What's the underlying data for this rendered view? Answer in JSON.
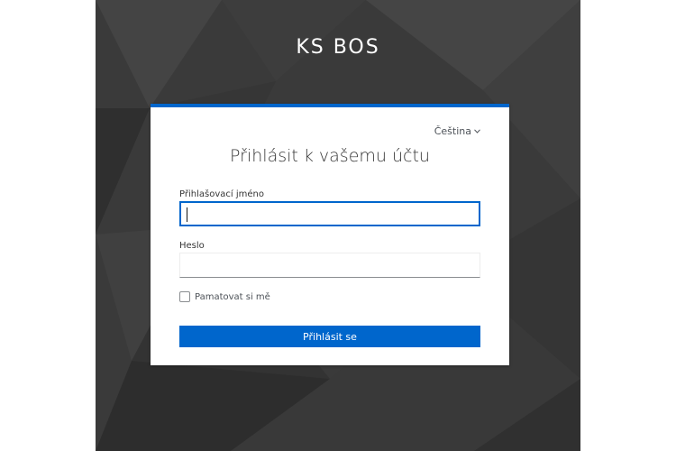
{
  "brand": {
    "title": "KS BOS"
  },
  "login": {
    "language": "Čeština",
    "heading": "Přihlásit k vašemu účtu",
    "username_label": "Přihlašovací jméno",
    "username_value": "",
    "password_label": "Heslo",
    "password_value": "",
    "remember_label": "Pamatovat si mě",
    "remember_checked": false,
    "submit_label": "Přihlásit se"
  },
  "colors": {
    "accent": "#0066cc",
    "background_dark": "#3a3a3a"
  },
  "icons": {
    "language_dropdown": "chevron-down-icon"
  }
}
